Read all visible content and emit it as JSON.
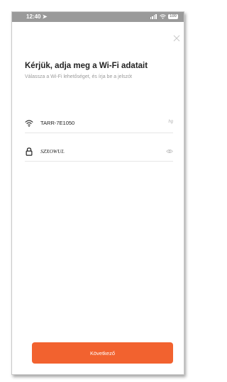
{
  "status_bar": {
    "time": "12:40",
    "battery": "100"
  },
  "header": {
    "title": "Kérjük, adja meg a Wi-Fi adatait",
    "subtitle": "Válassza a Wi-Fi lehetőséget, és írja be a jelszót"
  },
  "wifi": {
    "ssid": "TARR-7E1050",
    "ssid_aux": "hg",
    "password": "SZXOWUL"
  },
  "footer": {
    "next_label": "Következő"
  },
  "icons": {
    "close": "close-icon",
    "wifi": "wifi-icon",
    "lock": "lock-icon",
    "eye": "eye-icon"
  },
  "colors": {
    "accent": "#f2622f",
    "status_bar": "#9a9a9a",
    "text": "#222222",
    "muted": "#9a9a9a"
  }
}
